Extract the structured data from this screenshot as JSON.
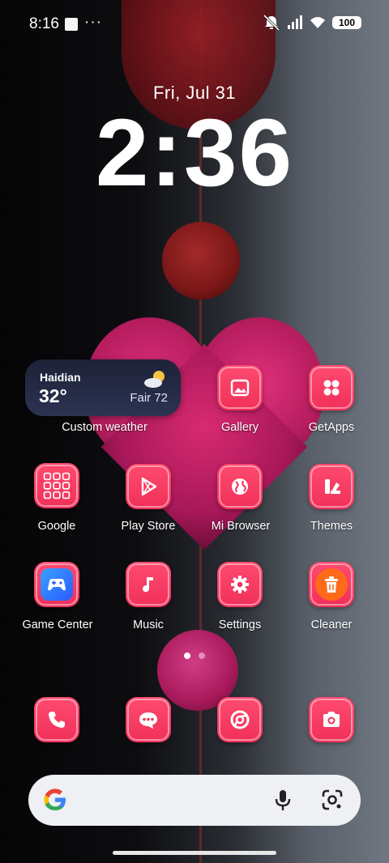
{
  "status_bar": {
    "time": "8:16",
    "overflow": "···",
    "battery": "100",
    "icons": [
      "notification-square-icon",
      "mute-icon",
      "signal-icon",
      "wifi-icon",
      "battery-icon"
    ]
  },
  "lockclock": {
    "date": "Fri, Jul 31",
    "time": "2:36"
  },
  "weather_widget": {
    "city": "Haidian",
    "temperature": "32°",
    "condition": "Fair 72",
    "label": "Custom weather"
  },
  "apps": [
    {
      "id": "gallery",
      "label": "Gallery",
      "icon": "gallery-icon"
    },
    {
      "id": "getapps",
      "label": "GetApps",
      "icon": "getapps-icon"
    },
    {
      "id": "google",
      "label": "Google",
      "icon": "google-folder-icon"
    },
    {
      "id": "playstore",
      "label": "Play Store",
      "icon": "play-store-icon"
    },
    {
      "id": "mibrowser",
      "label": "Mi Browser",
      "icon": "browser-globe-icon"
    },
    {
      "id": "themes",
      "label": "Themes",
      "icon": "themes-icon"
    },
    {
      "id": "gamecenter",
      "label": "Game Center",
      "icon": "game-controller-icon"
    },
    {
      "id": "music",
      "label": "Music",
      "icon": "music-note-icon"
    },
    {
      "id": "settings",
      "label": "Settings",
      "icon": "gear-icon"
    },
    {
      "id": "cleaner",
      "label": "Cleaner",
      "icon": "trash-icon"
    }
  ],
  "dock": [
    {
      "id": "phone",
      "icon": "phone-icon"
    },
    {
      "id": "messages",
      "icon": "message-icon"
    },
    {
      "id": "chrome",
      "icon": "chrome-icon"
    },
    {
      "id": "camera",
      "icon": "camera-icon"
    }
  ],
  "pager": {
    "pages": 2,
    "current": 1
  },
  "search_bar": {
    "mic": "microphone-icon",
    "lens": "google-lens-icon"
  },
  "colors": {
    "app_accent": "#f0305a",
    "widget_bg": "#1d2237"
  }
}
